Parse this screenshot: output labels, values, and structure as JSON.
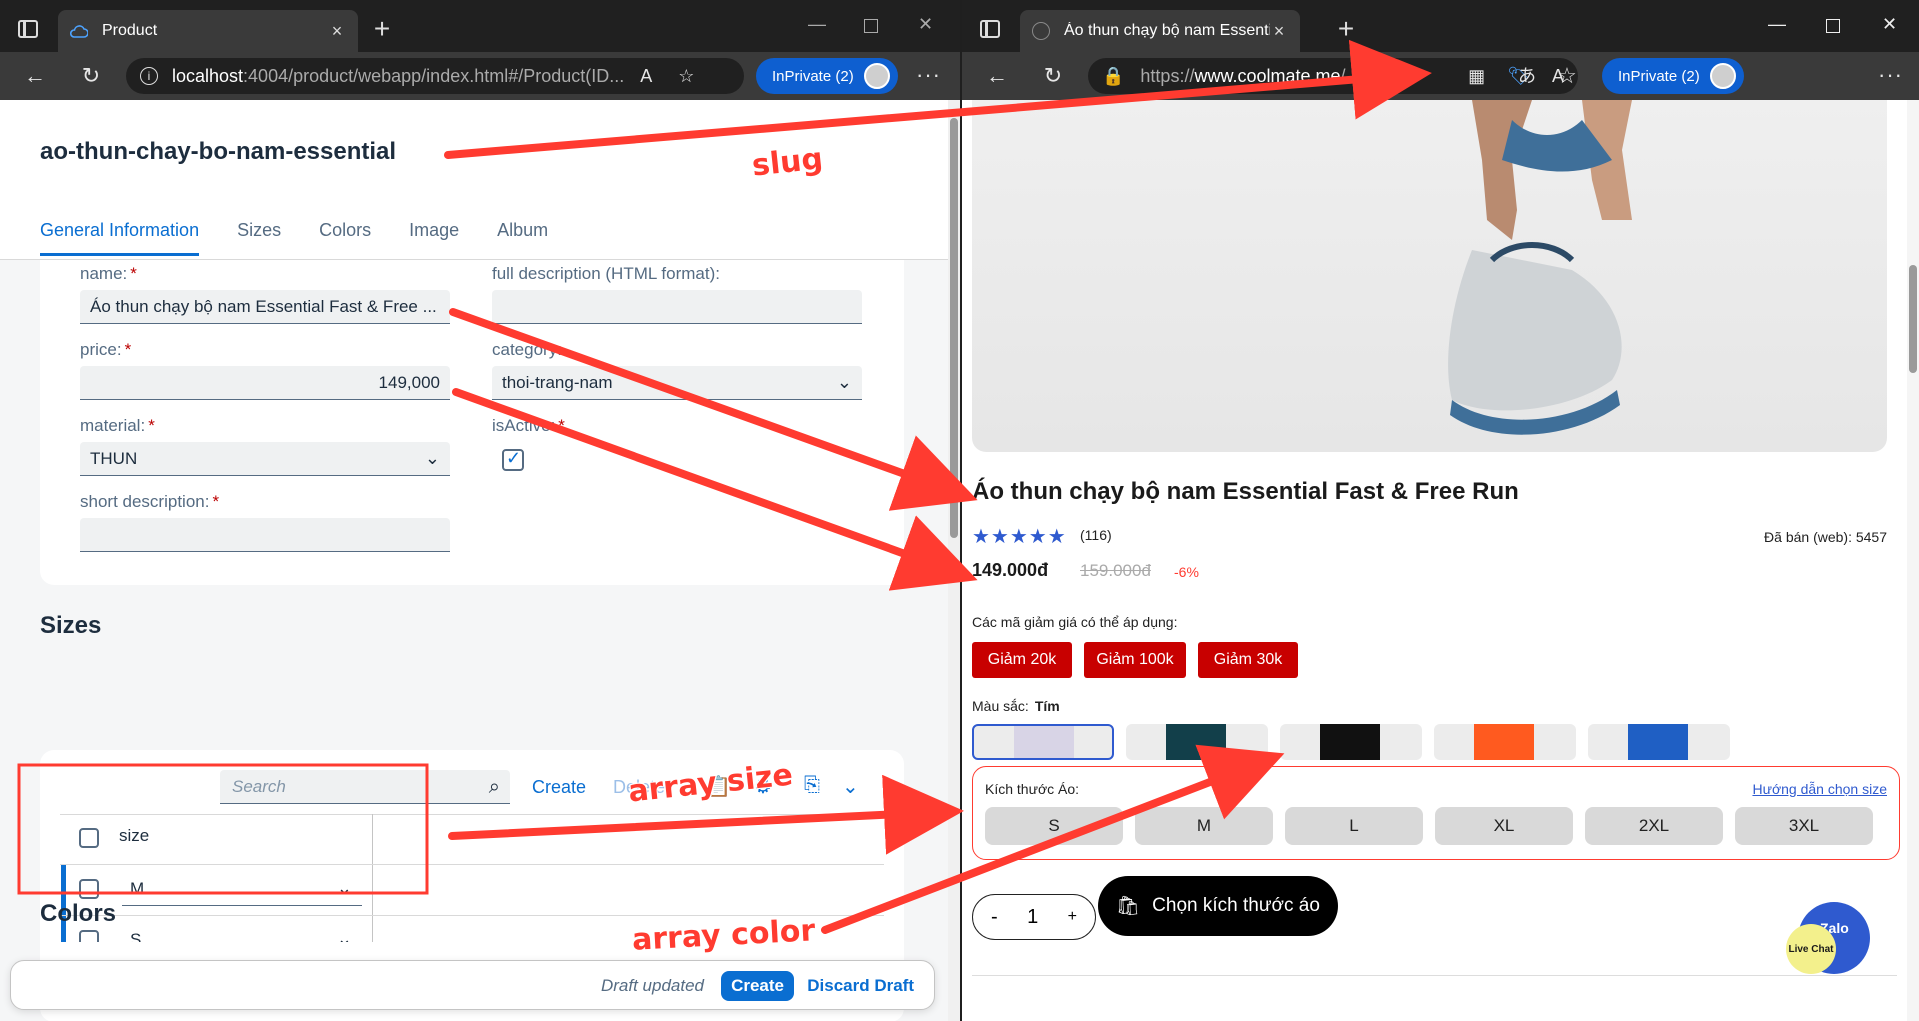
{
  "left_browser": {
    "tab_title": "Product",
    "url_host": "localhost",
    "url_path": ":4004/product/webapp/index.html#/Product(ID...",
    "inprivate": "InPrivate (2)"
  },
  "right_browser": {
    "tab_title": "Áo thun chạy bộ nam Essential F",
    "url_prefix": "https://",
    "url_host": "www.coolmate.me",
    "url_path": "/...",
    "inprivate": "InPrivate (2)"
  },
  "app": {
    "slug": "ao-thun-chay-bo-nam-essential",
    "tabs": [
      "General Information",
      "Sizes",
      "Colors",
      "Image",
      "Album"
    ],
    "fields": {
      "name_label": "name:",
      "name_value": "Áo thun chạy bộ nam Essential Fast & Free ...",
      "full_desc_label": "full description (HTML format):",
      "full_desc_value": "",
      "price_label": "price:",
      "price_value": "149,000",
      "category_label": "category:",
      "category_value": "thoi-trang-nam",
      "material_label": "material:",
      "material_value": "THUN",
      "isactive_label": "isActive:",
      "short_desc_label": "short description:",
      "short_desc_value": "",
      "required_mark": "*"
    },
    "sizes_section": {
      "title": "Sizes",
      "search_placeholder": "Search",
      "create": "Create",
      "delete": "Delete",
      "column": "size",
      "rows": [
        "M",
        "S"
      ]
    },
    "colors_section": {
      "title": "Colors"
    },
    "footer": {
      "status": "Draft updated",
      "create": "Create",
      "discard": "Discard Draft"
    }
  },
  "product_page": {
    "title": "Áo thun chạy bộ nam Essential Fast & Free Run",
    "stars": "★★★★★",
    "reviews": "(116)",
    "sold": "Đã bán (web): 5457",
    "price": "149.000đ",
    "old_price": "159.000đ",
    "discount": "-6%",
    "coupon_label": "Các mã giảm giá có thể áp dụng:",
    "coupons": [
      "Giảm 20k",
      "Giảm 100k",
      "Giảm 30k"
    ],
    "color_label": "Màu sắc:",
    "color_selected": "Tím",
    "swatch_colors": [
      "#d8d4e6",
      "#123f4a",
      "#111111",
      "#ff5a1f",
      "#1f5fc4"
    ],
    "size_label": "Kích thước Áo:",
    "size_guide": "Hướng dẫn chọn size",
    "sizes": [
      "S",
      "M",
      "L",
      "XL",
      "2XL",
      "3XL"
    ],
    "qty_minus": "-",
    "qty_value": "1",
    "qty_plus": "+",
    "cta": "Chọn kích thước áo",
    "zalo": "Zalo",
    "live_chat": "Live Chat"
  },
  "annotations": {
    "slug": "slug",
    "array_size": "array size",
    "array_color": "array color"
  },
  "colors": {
    "sap_blue": "#0a6ed1",
    "annotation_red": "#ff3b30",
    "coupon_red": "#c80000",
    "brand_blue": "#2f5acf"
  }
}
